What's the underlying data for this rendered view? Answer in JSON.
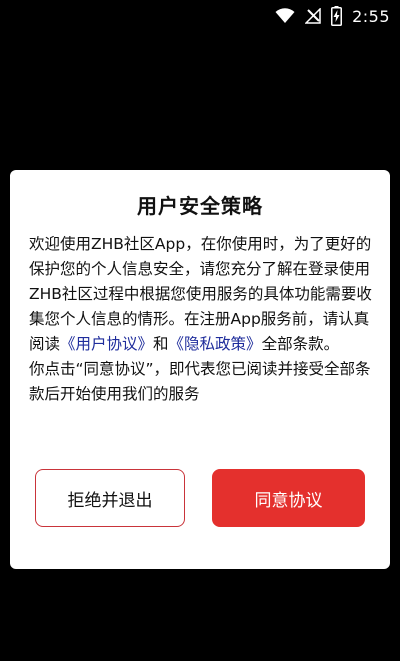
{
  "status_bar": {
    "time": "2:55",
    "icons": [
      "wifi-icon",
      "signal-off-icon",
      "battery-charging-icon"
    ]
  },
  "dialog": {
    "title": "用户安全策略",
    "body": {
      "part1": "欢迎使用ZHB社区App，在你使用时，为了更好的保护您的个人信息安全，请您充分了解在登录使用ZHB社区过程中根据您使用服务的具体功能需要收集您个人信息的情形。在注册App服务前，请认真阅读",
      "user_agreement_link": "《用户协议》",
      "and": "和",
      "privacy_policy_link": "《隐私政策》",
      "part2": "全部条款。",
      "part3": "你点击“同意协议”，即代表您已阅读并接受全部条款后开始使用我们的服务"
    },
    "reject_button": "拒绝并退出",
    "agree_button": "同意协议"
  },
  "colors": {
    "accent": "#e4302d",
    "link": "#1f2d9c",
    "background": "#000000"
  }
}
